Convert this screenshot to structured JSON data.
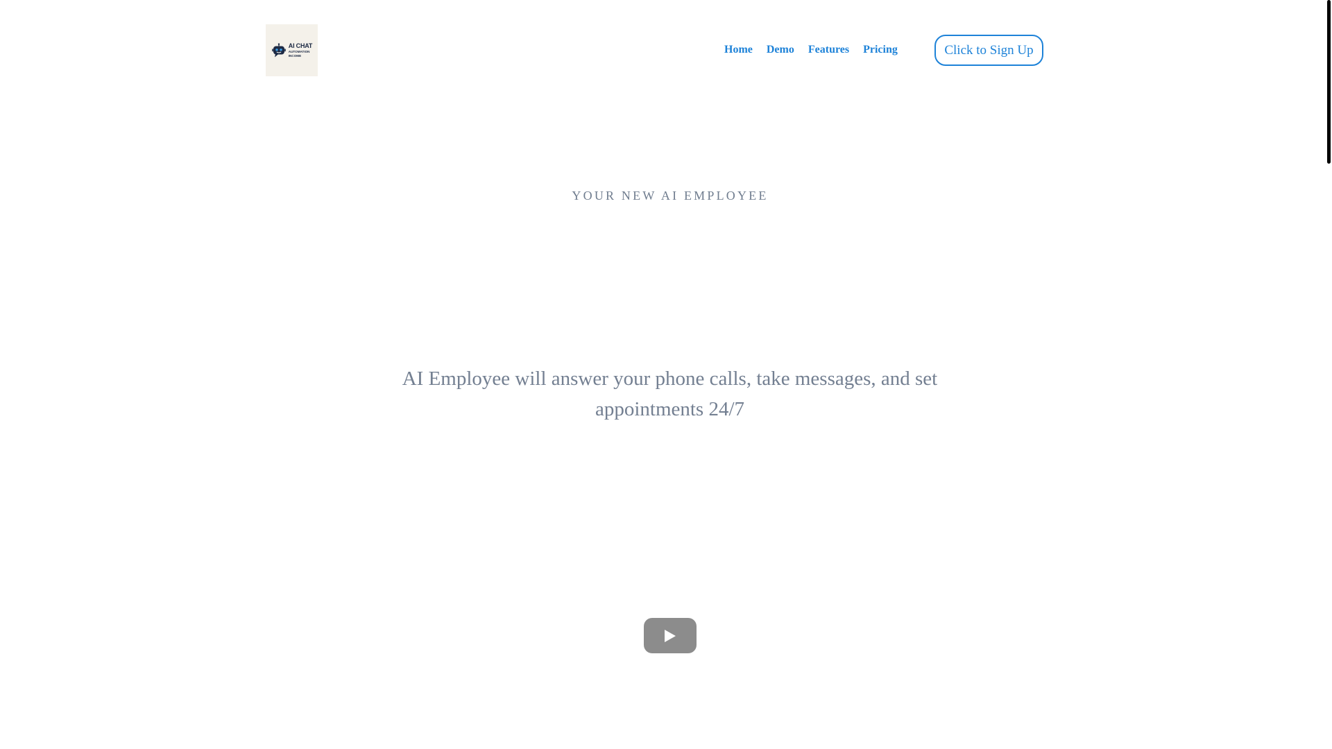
{
  "header": {
    "logo": {
      "line1": "AI CHAT",
      "line2": "AUTOMATION",
      "line3": "INCOME",
      "icon": "robot-chat-icon"
    },
    "nav": [
      {
        "label": "Home"
      },
      {
        "label": "Demo"
      },
      {
        "label": "Features"
      },
      {
        "label": "Pricing"
      }
    ],
    "signup_label": "Click to Sign Up"
  },
  "hero": {
    "eyebrow": "YOUR NEW AI EMPLOYEE",
    "headline": "AI Employee will answer your phone calls, take messages, and set appointments 24/7"
  },
  "video": {
    "play_icon": "play-icon"
  },
  "colors": {
    "accent": "#1d82d8",
    "eyebrow_text": "#6f7c8e",
    "headline_text": "#737f91",
    "logo_bg": "#f4f1ea",
    "logo_text": "#1d2a44",
    "play_button": "#8c8c8c"
  }
}
